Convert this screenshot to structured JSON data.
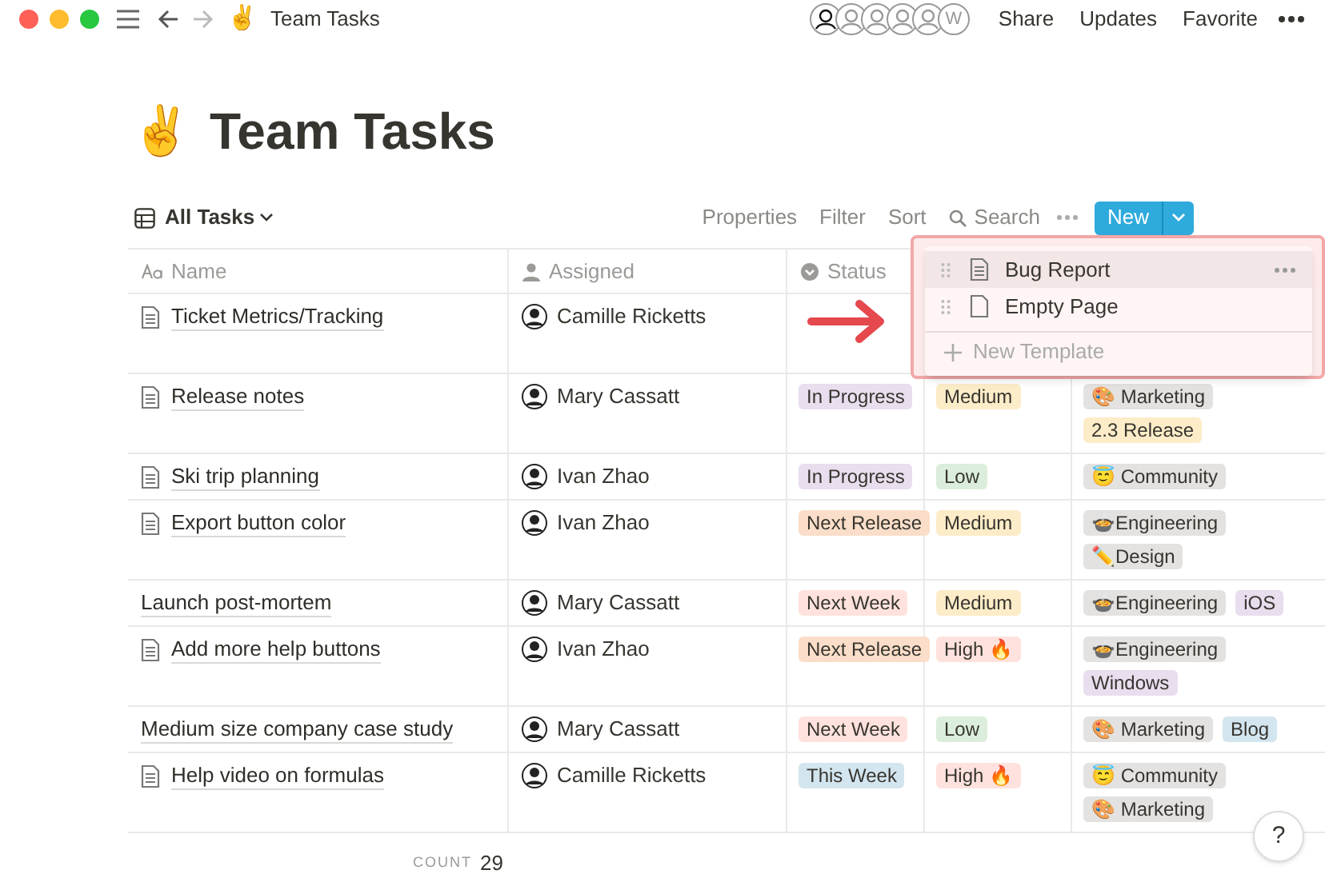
{
  "topbar": {
    "emoji": "✌️",
    "breadcrumb": "Team Tasks",
    "avatars": [
      {
        "kind": "face"
      },
      {
        "kind": "face"
      },
      {
        "kind": "face"
      },
      {
        "kind": "face"
      },
      {
        "kind": "face"
      },
      {
        "kind": "initial",
        "initial": "W"
      }
    ],
    "actions": [
      "Share",
      "Updates",
      "Favorite"
    ]
  },
  "page": {
    "emoji": "✌️",
    "title": "Team Tasks"
  },
  "toolbar": {
    "view": "All Tasks",
    "actions": [
      "Properties",
      "Filter",
      "Sort"
    ],
    "search": "Search",
    "new_button": "New"
  },
  "table": {
    "columns": [
      "Name",
      "Assigned",
      "Status"
    ],
    "rows": [
      {
        "kind": "page",
        "name": "Ticket Metrics/Tracking",
        "assigned": "Camille Ricketts",
        "status": [],
        "priority": [],
        "tags": []
      },
      {
        "kind": "page",
        "name": "Release notes",
        "assigned": "Mary Cassatt",
        "status": [
          {
            "text": "In Progress",
            "color": "#e8deee"
          }
        ],
        "priority": [
          {
            "text": "Medium",
            "color": "#fdecc8"
          }
        ],
        "tags": [
          {
            "text": "🎨 Marketing",
            "color": "#e3e2e0"
          },
          {
            "text": "2.3 Release",
            "color": "#fdecc8"
          }
        ]
      },
      {
        "kind": "page",
        "name": "Ski trip planning",
        "assigned": "Ivan Zhao",
        "status": [
          {
            "text": "In Progress",
            "color": "#e8deee"
          }
        ],
        "priority": [
          {
            "text": "Low",
            "color": "#dbeddb"
          }
        ],
        "tags": [
          {
            "text": "😇 Community",
            "color": "#e3e2e0"
          }
        ]
      },
      {
        "kind": "page",
        "name": "Export button color",
        "assigned": "Ivan Zhao",
        "status": [
          {
            "text": "Next Release",
            "color": "#fadec9"
          }
        ],
        "priority": [
          {
            "text": "Medium",
            "color": "#fdecc8"
          }
        ],
        "tags": [
          {
            "text": "🍲Engineering",
            "color": "#e3e2e0"
          },
          {
            "text": "✏️Design",
            "color": "#e3e2e0"
          }
        ]
      },
      {
        "kind": "plain",
        "name": "Launch post-mortem",
        "assigned": "Mary Cassatt",
        "status": [
          {
            "text": "Next Week",
            "color": "#ffe2dd"
          }
        ],
        "priority": [
          {
            "text": "Medium",
            "color": "#fdecc8"
          }
        ],
        "tags": [
          {
            "text": "🍲Engineering",
            "color": "#e3e2e0"
          },
          {
            "text": "iOS",
            "color": "#e8deee"
          }
        ]
      },
      {
        "kind": "page",
        "name": "Add more help buttons",
        "assigned": "Ivan Zhao",
        "status": [
          {
            "text": "Next Release",
            "color": "#fadec9"
          }
        ],
        "priority": [
          {
            "text": "High 🔥",
            "color": "#ffe2dd"
          }
        ],
        "tags": [
          {
            "text": "🍲Engineering",
            "color": "#e3e2e0"
          },
          {
            "text": "Windows",
            "color": "#e8deee"
          }
        ]
      },
      {
        "kind": "plain",
        "name": "Medium size company case study",
        "assigned": "Mary Cassatt",
        "status": [
          {
            "text": "Next Week",
            "color": "#ffe2dd"
          }
        ],
        "priority": [
          {
            "text": "Low",
            "color": "#dbeddb"
          }
        ],
        "tags": [
          {
            "text": "🎨 Marketing",
            "color": "#e3e2e0"
          },
          {
            "text": "Blog",
            "color": "#d3e5ef"
          }
        ]
      },
      {
        "kind": "page",
        "name": "Help video on formulas",
        "assigned": "Camille Ricketts",
        "status": [
          {
            "text": "This Week",
            "color": "#d3e5ef"
          }
        ],
        "priority": [
          {
            "text": "High 🔥",
            "color": "#ffe2dd"
          }
        ],
        "tags": [
          {
            "text": "😇 Community",
            "color": "#e3e2e0"
          },
          {
            "text": "🎨 Marketing",
            "color": "#e3e2e0"
          }
        ]
      }
    ]
  },
  "footer": {
    "count_label": "COUNT",
    "count": "29",
    "help": "?"
  },
  "template_menu": {
    "items": [
      {
        "label": "Bug Report",
        "selected": true,
        "kind": "filled"
      },
      {
        "label": "Empty Page",
        "selected": false,
        "kind": "blank"
      }
    ],
    "new_template": "New Template"
  }
}
